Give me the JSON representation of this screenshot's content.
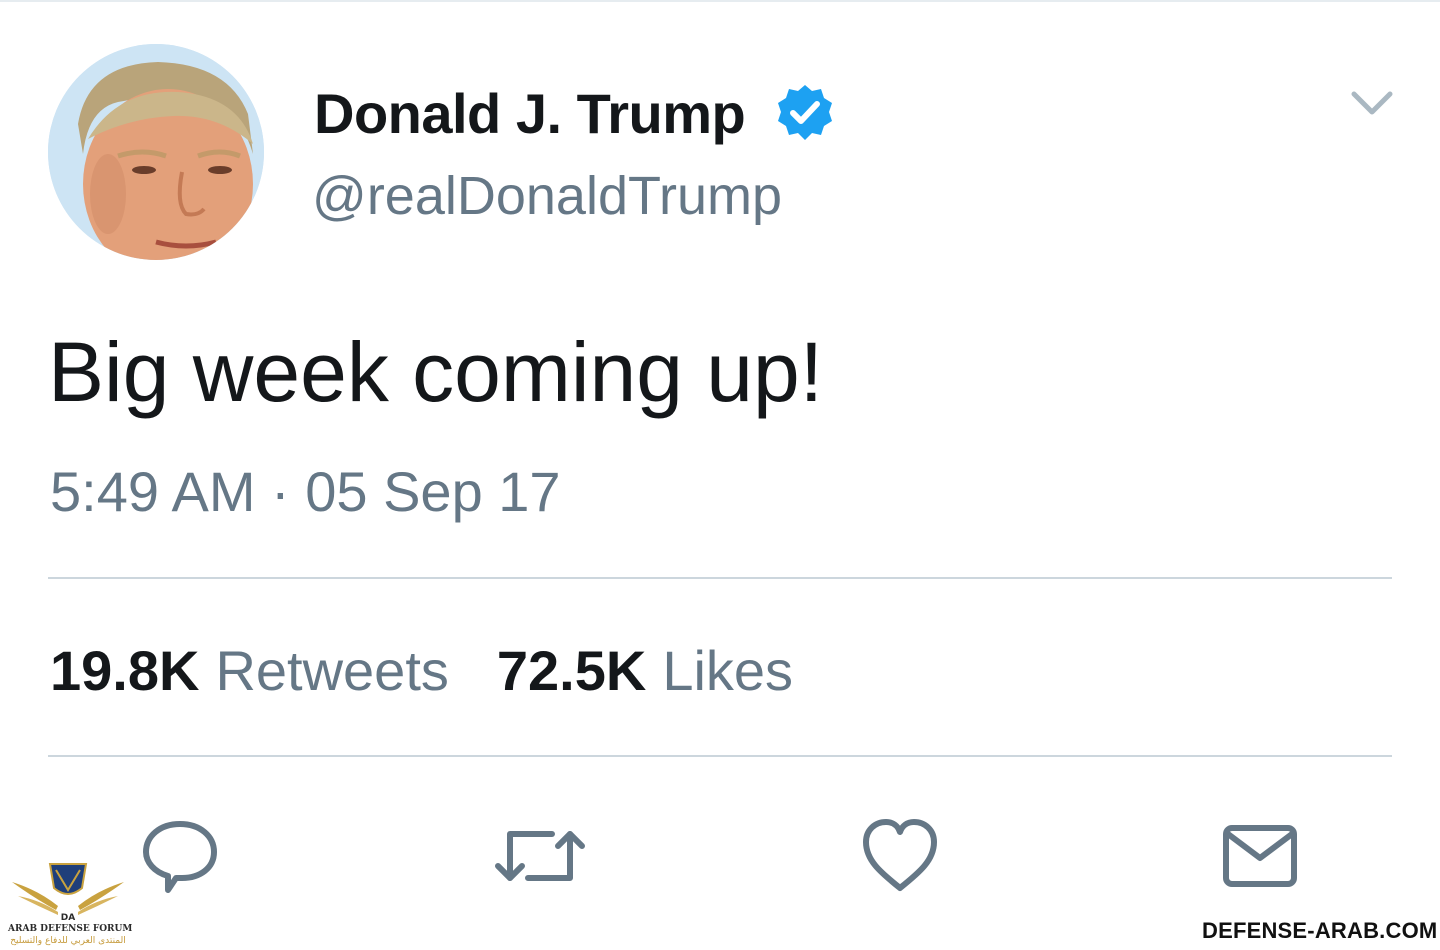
{
  "user": {
    "display_name": "Donald J. Trump",
    "handle": "@realDonaldTrump",
    "verified_icon": "verified-badge-icon",
    "avatar": "profile-photo"
  },
  "tweet": {
    "text": "Big week coming up!",
    "timestamp": "5:49 AM · 05 Sep 17"
  },
  "stats": {
    "retweets_count": "19.8K",
    "retweets_label": "Retweets",
    "likes_count": "72.5K",
    "likes_label": "Likes"
  },
  "actions": [
    {
      "name": "reply",
      "icon": "speech-bubble-icon"
    },
    {
      "name": "retweet",
      "icon": "retweet-arrows-icon"
    },
    {
      "name": "like",
      "icon": "heart-icon"
    },
    {
      "name": "direct-message",
      "icon": "envelope-icon"
    }
  ],
  "watermarks": {
    "left_title": "ARAB DEFENSE FORUM",
    "left_subtitle": "المنتدى العربي للدفاع والتسليح",
    "left_logo_letters": "DA",
    "right_text": "DEFENSE-ARAB.COM"
  },
  "colors": {
    "text_primary": "#14171a",
    "text_secondary": "#657786",
    "verified_blue": "#1da1f2",
    "divider": "#ccd6dd",
    "icon_gray": "#657786"
  }
}
